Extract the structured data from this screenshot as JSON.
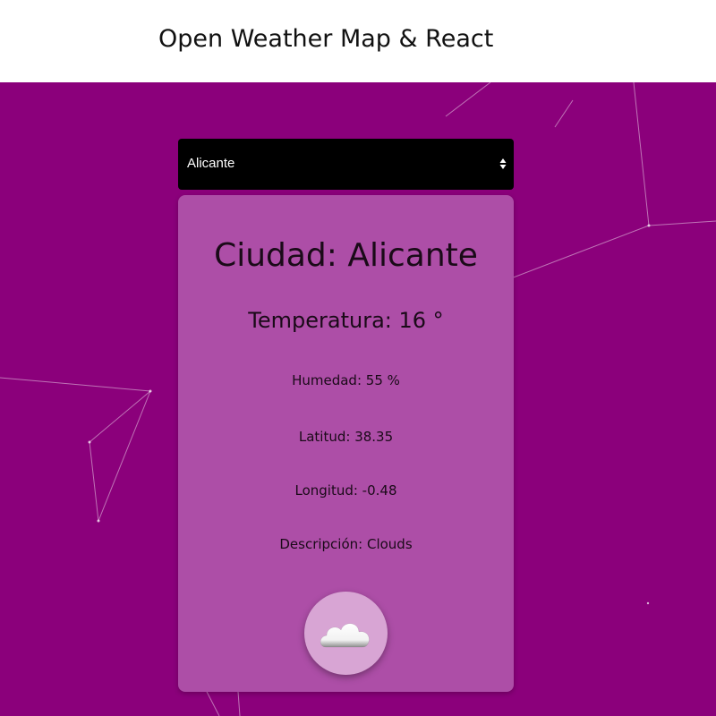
{
  "header": {
    "title": "Open Weather Map & React"
  },
  "city_select": {
    "selected": "Alicante"
  },
  "weather": {
    "city": "Ciudad: Alicante",
    "temperature": "Temperatura: 16 °",
    "humidity": "Humedad: 55 %",
    "latitude": "Latitud: 38.35",
    "longitude": "Longitud: -0.48",
    "description": "Descripción: Clouds",
    "icon": "cloud-icon"
  },
  "colors": {
    "background": "#8b007b",
    "card": "#ad4ea7",
    "select": "#000000",
    "icon_circle": "#d8a5d4"
  }
}
